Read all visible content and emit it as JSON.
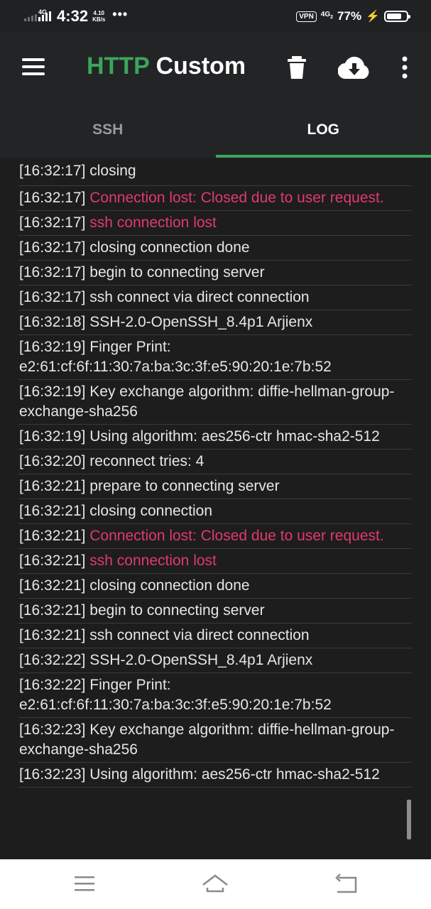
{
  "status_bar": {
    "network_label": "4G",
    "time": "4:32",
    "speed_value": "4.10",
    "speed_unit": "KB/s",
    "more": "•••",
    "vpn": "VPN",
    "lte": "4G",
    "lte_sub": "2",
    "battery_percent": "77%",
    "battery_level": 0.77
  },
  "toolbar": {
    "title_accent": "HTTP",
    "title_rest": " Custom",
    "accent_color": "#3ba55c"
  },
  "tabs": [
    {
      "label": "SSH",
      "active": false
    },
    {
      "label": "LOG",
      "active": true
    }
  ],
  "log": {
    "partial_top": "[16:32:17] closing",
    "entries": [
      {
        "time": "[16:32:17]",
        "message": "Connection lost: Closed due to user request.",
        "type": "error"
      },
      {
        "time": "[16:32:17]",
        "message": "ssh connection lost",
        "type": "error"
      },
      {
        "time": "[16:32:17]",
        "message": "closing connection done",
        "type": "info"
      },
      {
        "time": "[16:32:17]",
        "message": "begin to connecting server",
        "type": "info"
      },
      {
        "time": "[16:32:17]",
        "message": "ssh connect via direct connection",
        "type": "info"
      },
      {
        "time": "[16:32:18]",
        "message": "SSH-2.0-OpenSSH_8.4p1 Arjienx",
        "type": "info"
      },
      {
        "time": "[16:32:19]",
        "message": "Finger Print: e2:61:cf:6f:11:30:7a:ba:3c:3f:e5:90:20:1e:7b:52",
        "type": "info"
      },
      {
        "time": "[16:32:19]",
        "message": "Key exchange algorithm: diffie-hellman-group-exchange-sha256",
        "type": "info"
      },
      {
        "time": "[16:32:19]",
        "message": "Using algorithm: aes256-ctr hmac-sha2-512",
        "type": "info"
      },
      {
        "time": "[16:32:20]",
        "message": "reconnect tries: 4",
        "type": "info"
      },
      {
        "time": "[16:32:21]",
        "message": "prepare to connecting server",
        "type": "info"
      },
      {
        "time": "[16:32:21]",
        "message": "closing connection",
        "type": "info"
      },
      {
        "time": "[16:32:21]",
        "message": "Connection lost: Closed due to user request.",
        "type": "error"
      },
      {
        "time": "[16:32:21]",
        "message": "ssh connection lost",
        "type": "error"
      },
      {
        "time": "[16:32:21]",
        "message": "closing connection done",
        "type": "info"
      },
      {
        "time": "[16:32:21]",
        "message": "begin to connecting server",
        "type": "info"
      },
      {
        "time": "[16:32:21]",
        "message": "ssh connect via direct connection",
        "type": "info"
      },
      {
        "time": "[16:32:22]",
        "message": "SSH-2.0-OpenSSH_8.4p1 Arjienx",
        "type": "info"
      },
      {
        "time": "[16:32:22]",
        "message": "Finger Print: e2:61:cf:6f:11:30:7a:ba:3c:3f:e5:90:20:1e:7b:52",
        "type": "info"
      },
      {
        "time": "[16:32:23]",
        "message": "Key exchange algorithm: diffie-hellman-group-exchange-sha256",
        "type": "info"
      },
      {
        "time": "[16:32:23]",
        "message": "Using algorithm: aes256-ctr hmac-sha2-512",
        "type": "info"
      }
    ]
  },
  "nav": {
    "left_icon": "recents-icon",
    "center_icon": "home-icon",
    "right_icon": "back-icon"
  },
  "colors": {
    "error": "#e03a6b",
    "text": "#e6e6e6",
    "background": "#1d1d1d",
    "toolbar": "#222426"
  }
}
